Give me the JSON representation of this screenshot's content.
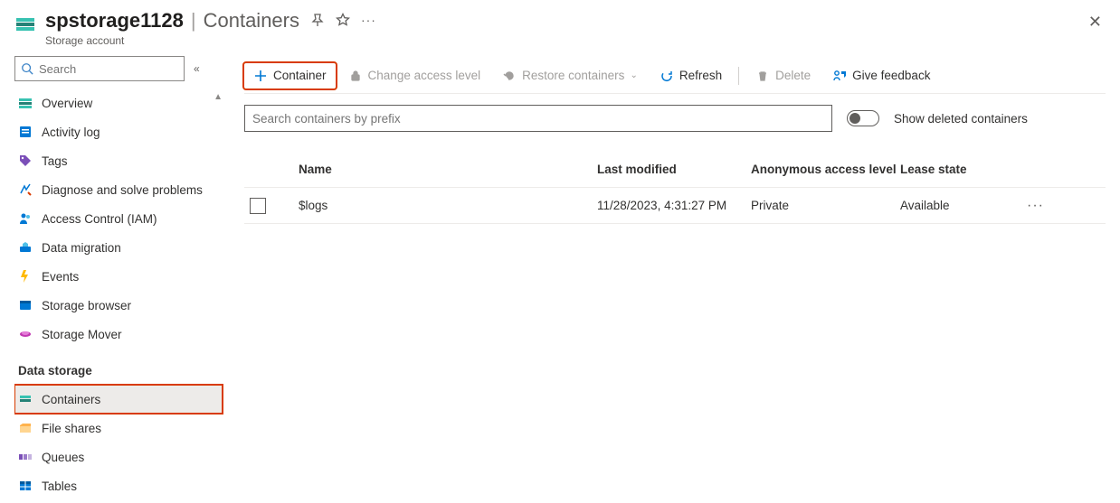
{
  "header": {
    "resource_name": "spstorage1128",
    "page_title": "Containers",
    "resource_type": "Storage account"
  },
  "sidebar": {
    "search_placeholder": "Search",
    "items": [
      {
        "label": "Overview",
        "icon": "overview"
      },
      {
        "label": "Activity log",
        "icon": "activity"
      },
      {
        "label": "Tags",
        "icon": "tags"
      },
      {
        "label": "Diagnose and solve problems",
        "icon": "diagnose"
      },
      {
        "label": "Access Control (IAM)",
        "icon": "iam"
      },
      {
        "label": "Data migration",
        "icon": "migration"
      },
      {
        "label": "Events",
        "icon": "events"
      },
      {
        "label": "Storage browser",
        "icon": "browser"
      },
      {
        "label": "Storage Mover",
        "icon": "mover"
      }
    ],
    "section_label": "Data storage",
    "storage_items": [
      {
        "label": "Containers",
        "icon": "containers",
        "selected": true,
        "highlight": true
      },
      {
        "label": "File shares",
        "icon": "fileshares"
      },
      {
        "label": "Queues",
        "icon": "queues"
      },
      {
        "label": "Tables",
        "icon": "tables"
      }
    ]
  },
  "toolbar": {
    "container": "Container",
    "change_access": "Change access level",
    "restore": "Restore containers",
    "refresh": "Refresh",
    "delete": "Delete",
    "feedback": "Give feedback"
  },
  "filters": {
    "search_placeholder": "Search containers by prefix",
    "toggle_label": "Show deleted containers"
  },
  "table": {
    "columns": {
      "name": "Name",
      "last_modified": "Last modified",
      "access_level": "Anonymous access level",
      "lease_state": "Lease state"
    },
    "rows": [
      {
        "name": "$logs",
        "last_modified": "11/28/2023, 4:31:27 PM",
        "access_level": "Private",
        "lease_state": "Available"
      }
    ]
  }
}
